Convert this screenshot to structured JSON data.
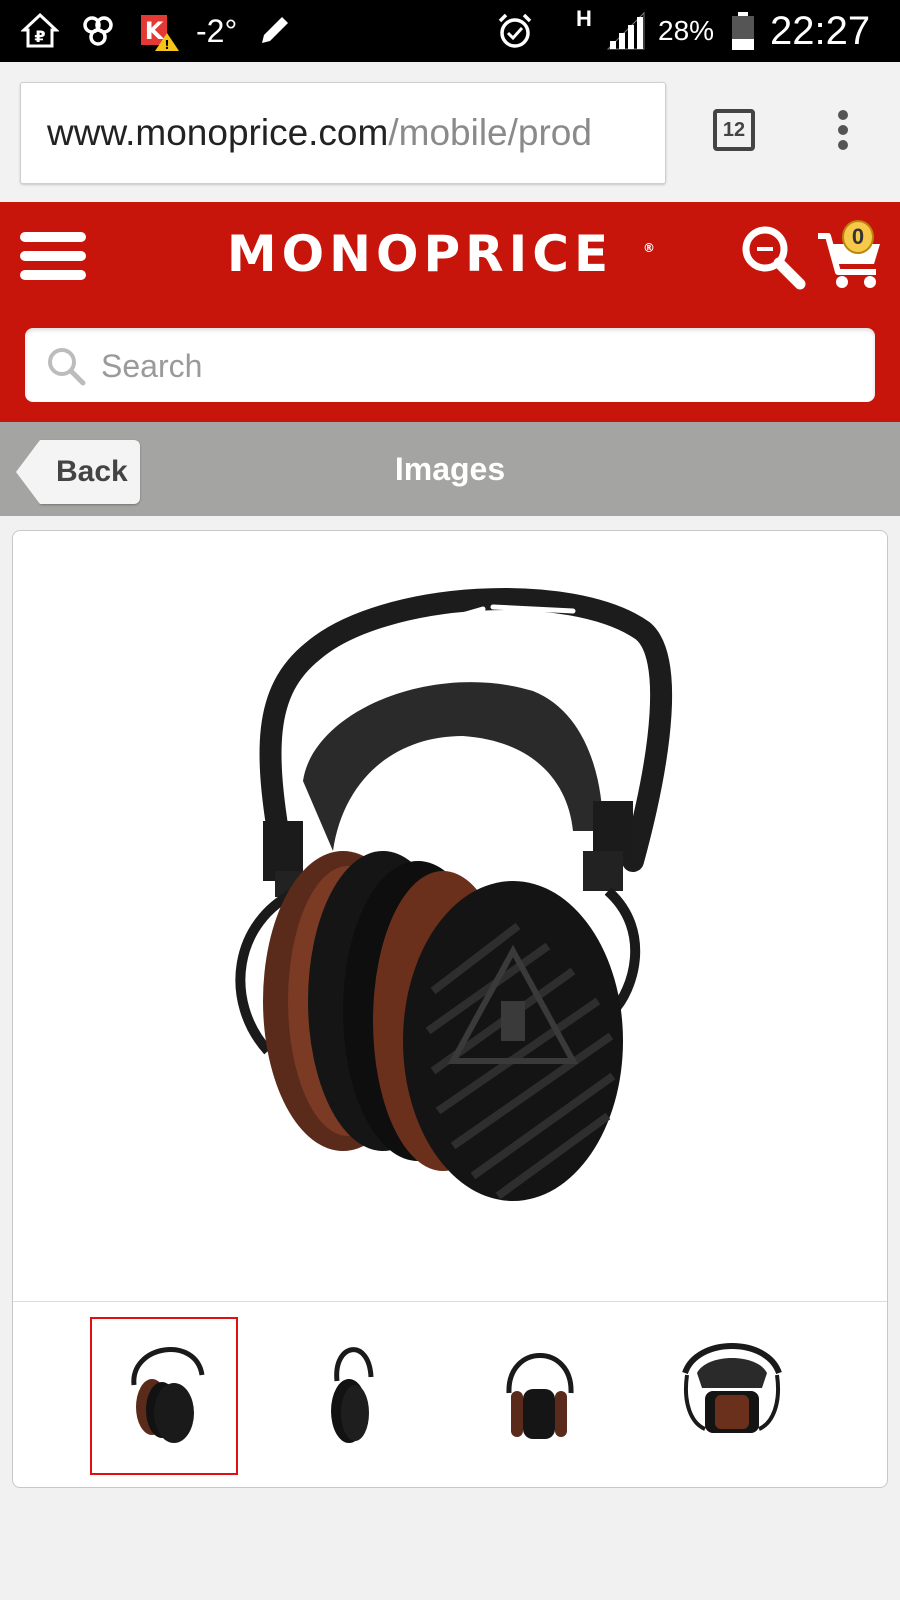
{
  "status_bar": {
    "temperature": "-2°",
    "network": "H",
    "battery": "28%",
    "time": "22:27"
  },
  "browser": {
    "url_domain": "www.monoprice.com",
    "url_path": "/mobile/prod",
    "tab_count": "12"
  },
  "header": {
    "logo": "MONOPRICE",
    "cart_count": "0",
    "search_placeholder": "Search",
    "brand_color": "#c8150b"
  },
  "toolbar": {
    "back_label": "Back",
    "title": "Images"
  },
  "gallery": {
    "main_image_icon": "headphones-image",
    "thumbnails": [
      {
        "view": "angled-front",
        "selected": true
      },
      {
        "view": "side",
        "selected": false
      },
      {
        "view": "front",
        "selected": false
      },
      {
        "view": "top-front",
        "selected": false
      }
    ],
    "selected_border_color": "#e01010"
  }
}
